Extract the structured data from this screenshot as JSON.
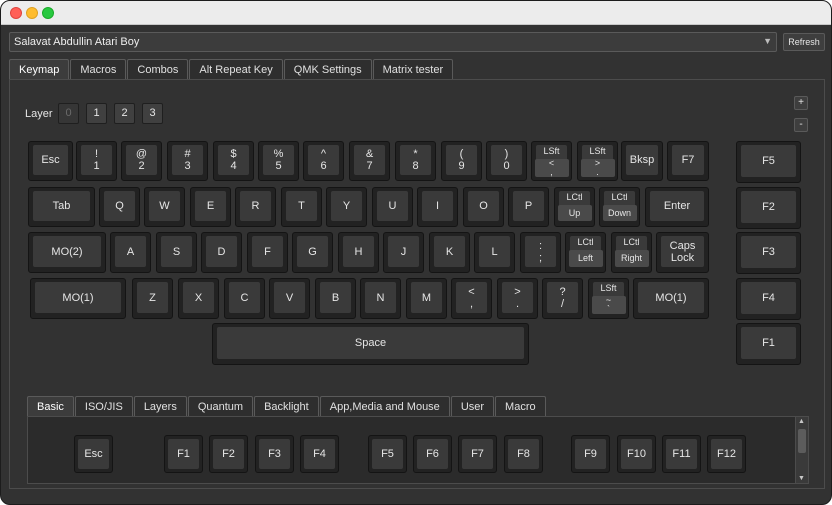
{
  "device": {
    "selected": "Salavat Abdullin Atari Boy"
  },
  "refresh_label": "Refresh",
  "tabs": [
    "Keymap",
    "Macros",
    "Combos",
    "Alt Repeat Key",
    "QMK Settings",
    "Matrix tester"
  ],
  "layer": {
    "label": "Layer",
    "buttons": [
      "0",
      "1",
      "2",
      "3"
    ]
  },
  "zoom": {
    "plus": "+",
    "minus": "-"
  },
  "keys": {
    "esc": "Esc",
    "bksp": "Bksp",
    "f7": "F7",
    "f5": "F5",
    "n1_top": "!",
    "n1_bot": "1",
    "n2_top": "@",
    "n2_bot": "2",
    "n3_top": "#",
    "n3_bot": "3",
    "n4_top": "$",
    "n4_bot": "4",
    "n5_top": "%",
    "n5_bot": "5",
    "n6_top": "^",
    "n6_bot": "6",
    "n7_top": "&",
    "n7_bot": "7",
    "n8_top": "*",
    "n8_bot": "8",
    "n9_top": "(",
    "n9_bot": "9",
    "n0_top": ")",
    "n0_bot": "0",
    "lsft_lt_mod": "LSft",
    "lsft_lt_top": "<",
    "lsft_lt_bot": ",",
    "lsft_gt_mod": "LSft",
    "lsft_gt_top": ">",
    "lsft_gt_bot": ".",
    "tab": "Tab",
    "q": "Q",
    "w": "W",
    "e": "E",
    "r": "R",
    "t": "T",
    "y": "Y",
    "u": "U",
    "i": "I",
    "o": "O",
    "p": "P",
    "lctl_up_mod": "LCtl",
    "lctl_up_key": "Up",
    "lctl_down_mod": "LCtl",
    "lctl_down_key": "Down",
    "enter": "Enter",
    "f2": "F2",
    "mo2": "MO(2)",
    "a": "A",
    "s": "S",
    "d": "D",
    "f": "F",
    "g": "G",
    "h": "H",
    "j": "J",
    "k": "K",
    "l": "L",
    "semi_top": ":",
    "semi_bot": ";",
    "lctl_left_mod": "LCtl",
    "lctl_left_key": "Left",
    "lctl_right_mod": "LCtl",
    "lctl_right_key": "Right",
    "caps_top": "Caps",
    "caps_bot": "Lock",
    "f3": "F3",
    "mo1_left": "MO(1)",
    "z": "Z",
    "x": "X",
    "c": "C",
    "v": "V",
    "b": "B",
    "n": "N",
    "m": "M",
    "lt_top": "<",
    "lt_bot": ",",
    "gt_top": ">",
    "gt_bot": ".",
    "q_top": "?",
    "q_bot": "/",
    "lsft_tilde_mod": "LSft",
    "lsft_tilde_top": "~",
    "lsft_tilde_bot": "`",
    "mo1_right": "MO(1)",
    "f4": "F4",
    "space": "Space",
    "f1": "F1"
  },
  "bottom_tabs": [
    "Basic",
    "ISO/JIS",
    "Layers",
    "Quantum",
    "Backlight",
    "App,Media and Mouse",
    "User",
    "Macro"
  ],
  "palette": [
    "Esc",
    "F1",
    "F2",
    "F3",
    "F4",
    "F5",
    "F6",
    "F7",
    "F8",
    "F9",
    "F10",
    "F11",
    "F12"
  ],
  "colors": {
    "window_bg": "#323232",
    "key_bg": "#3a3a3a",
    "key_border": "#222222",
    "text": "#e6e6e6"
  }
}
